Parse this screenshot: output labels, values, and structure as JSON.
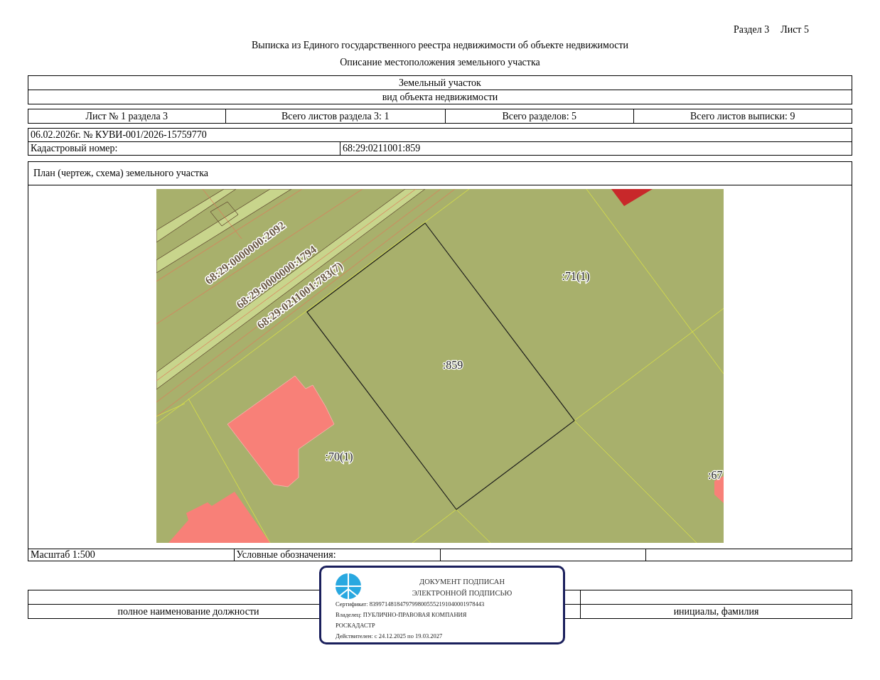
{
  "header": {
    "section": "Раздел 3",
    "sheet": "Лист 5"
  },
  "title": "Выписка из Единого государственного реестра недвижимости об объекте недвижимости",
  "subtitle": "Описание местоположения земельного участка",
  "object": {
    "name": "Земельный участок",
    "caption": "вид объекта недвижимости"
  },
  "counts": [
    "Лист № 1 раздела 3",
    "Всего листов раздела 3: 1",
    "Всего разделов: 5",
    "Всего листов выписки: 9"
  ],
  "record": {
    "date_number": "06.02.2026г. № КУВИ-001/2026-15759770",
    "cadastral_label": "Кадастровый номер:",
    "cadastral_number": "68:29:0211001:859"
  },
  "plan": {
    "title": "План (чертеж, схема) земельного участка",
    "labels": [
      {
        "kind": "road",
        "text": "68:29:0000000:2092"
      },
      {
        "kind": "road",
        "text": "68:29:0000000:1794"
      },
      {
        "kind": "road",
        "text": "68:29:0211001:783(7)"
      },
      {
        "kind": "parcel",
        "text": ":71(1)"
      },
      {
        "kind": "parcel",
        "text": ":859"
      },
      {
        "kind": "parcel",
        "text": ":70(1)"
      },
      {
        "kind": "parcel",
        "text": ":67"
      }
    ],
    "scale": "Масштаб 1:500",
    "legend": "Условные обозначения:"
  },
  "signature": {
    "position": "полное наименование должности",
    "name": "инициалы, фамилия"
  },
  "stamp": {
    "lines": [
      "ДОКУМЕНТ ПОДПИСАН",
      "ЭЛЕКТРОННОЙ ПОДПИСЬЮ"
    ],
    "details": [
      "Сертификат: 83997148184797998005552191040001978443",
      "Владелец: ПУБЛИЧНО-ПРАВОВАЯ КОМПАНИЯ",
      "РОСКАДАСТР",
      "Действителен: с 24.12.2025 по 19.03.2027"
    ]
  }
}
